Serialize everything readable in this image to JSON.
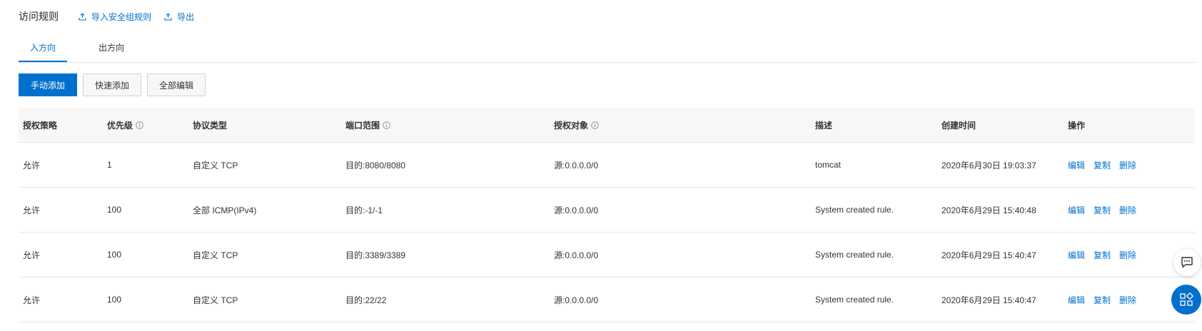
{
  "header": {
    "title": "访问规则",
    "import_label": "导入安全组规则",
    "export_label": "导出"
  },
  "tabs": [
    {
      "label": "入方向",
      "active": true
    },
    {
      "label": "出方向",
      "active": false
    }
  ],
  "toolbar": {
    "manual_add": "手动添加",
    "quick_add": "快速添加",
    "edit_all": "全部编辑"
  },
  "table": {
    "columns": [
      "授权策略",
      "优先级",
      "协议类型",
      "端口范围",
      "授权对象",
      "描述",
      "创建时间",
      "操作"
    ],
    "rows": [
      {
        "policy": "允许",
        "priority": "1",
        "protocol": "自定义 TCP",
        "port": "目的:8080/8080",
        "object": "源:0.0.0.0/0",
        "desc": "tomcat",
        "created": "2020年6月30日 19:03:37"
      },
      {
        "policy": "允许",
        "priority": "100",
        "protocol": "全部 ICMP(IPv4)",
        "port": "目的:-1/-1",
        "object": "源:0.0.0.0/0",
        "desc": "System created rule.",
        "created": "2020年6月29日 15:40:48"
      },
      {
        "policy": "允许",
        "priority": "100",
        "protocol": "自定义 TCP",
        "port": "目的:3389/3389",
        "object": "源:0.0.0.0/0",
        "desc": "System created rule.",
        "created": "2020年6月29日 15:40:47"
      },
      {
        "policy": "允许",
        "priority": "100",
        "protocol": "自定义 TCP",
        "port": "目的:22/22",
        "object": "源:0.0.0.0/0",
        "desc": "System created rule.",
        "created": "2020年6月29日 15:40:47"
      }
    ],
    "actions": {
      "edit": "编辑",
      "copy": "复制",
      "delete": "删除"
    }
  },
  "colors": {
    "accent": "#0070cc",
    "header_bg": "#f7f7f7",
    "border": "#e5e5e5"
  },
  "icons": {
    "import": "upload-icon",
    "export": "upload-icon",
    "info": "info-circle-icon",
    "chat": "chat-icon",
    "apps": "apps-grid-icon"
  }
}
